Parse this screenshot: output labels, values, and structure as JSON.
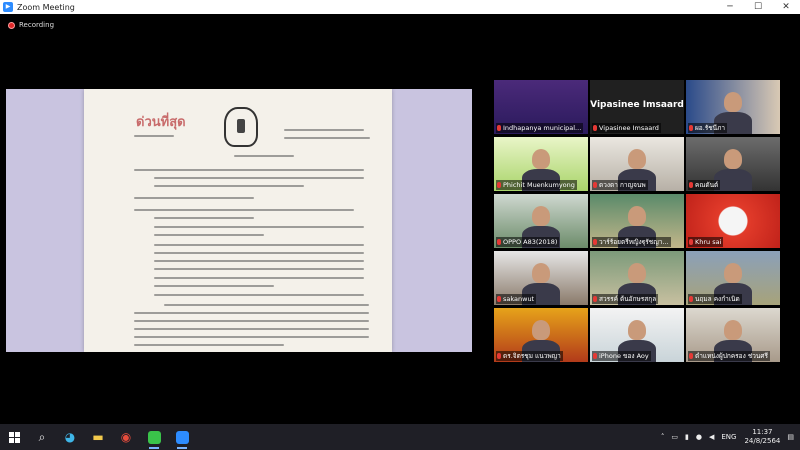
{
  "window": {
    "title": "Zoom Meeting"
  },
  "recording": {
    "label": "Recording"
  },
  "shared_document": {
    "heading": "ด่วนที่สุด"
  },
  "participants": [
    {
      "name": "Indhapanya municipal..."
    },
    {
      "name": "Vipasinee Imsaard",
      "display": "Vipasinee Imsaard"
    },
    {
      "name": "ผอ.รัชนีภา"
    },
    {
      "name": "Phichit Muenkumyong"
    },
    {
      "name": "ดวงดา กาญจนพ"
    },
    {
      "name": "คณตันต์"
    },
    {
      "name": "OPPO A83(2018)"
    },
    {
      "name": "วาร์ร้อยตรีหญิงฐุรัชญา..."
    },
    {
      "name": "Khru sai"
    },
    {
      "name": "sakanwut"
    },
    {
      "name": "สวรรค์ ต้นอักษรสกุล"
    },
    {
      "name": "นฤมล คงกำเนิด"
    },
    {
      "name": "ดร.จิตรชุม แนวพญา"
    },
    {
      "name": "iPhone ของ Aoy"
    },
    {
      "name": "ตำแหน่งผู้ปกครอง ช่วนศรี"
    }
  ],
  "taskbar": {
    "language": "ENG",
    "time": "11:37",
    "date": "24/8/2564"
  },
  "colors": {
    "accent": "#2d8cff",
    "active_speaker": "#b8d94a",
    "recording": "#e02828"
  }
}
